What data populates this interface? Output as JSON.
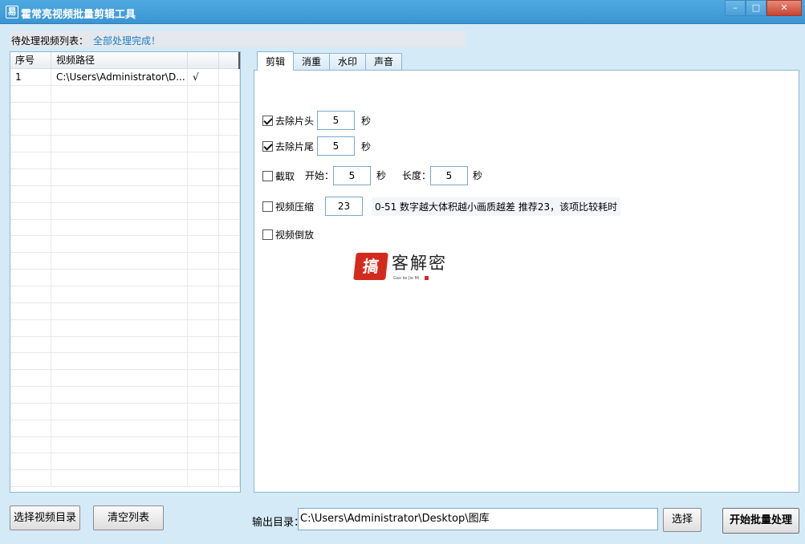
{
  "window": {
    "title": "霍常亮视频批量剪辑工具",
    "app_icon_glyph": "易",
    "minimize": "–",
    "maximize": "□",
    "close": "✕"
  },
  "status": {
    "label": "待处理视频列表：",
    "value": "全部处理完成！",
    "value_color": "#1a7ec4"
  },
  "list": {
    "columns": [
      "序号",
      "视频路径",
      ""
    ],
    "rows": [
      {
        "index": "1",
        "path": "C:\\Users\\Administrator\\D...",
        "status": "√"
      }
    ]
  },
  "tabs": [
    "剪辑",
    "消重",
    "水印",
    "声音"
  ],
  "edit": {
    "remove_head": {
      "label": "去除片头",
      "checked": true,
      "value": "5",
      "unit": "秒"
    },
    "remove_tail": {
      "label": "去除片尾",
      "checked": true,
      "value": "5",
      "unit": "秒"
    },
    "clip": {
      "label": "截取",
      "checked": false,
      "start_label": "开始：",
      "start_value": "5",
      "start_unit": "秒",
      "length_label": "长度：",
      "length_value": "5",
      "length_unit": "秒"
    },
    "compress": {
      "label": "视频压缩",
      "checked": false,
      "value": "23",
      "hint": "0-51 数字越大体积越小画质越差 推荐23，该项比较耗时"
    },
    "reverse": {
      "label": "视频倒放",
      "checked": false
    }
  },
  "watermark": {
    "seal_text": "搞",
    "text": "客解密",
    "subtext": "Gao ke Jie Mi"
  },
  "buttons": {
    "select_dir": "选择视频目录",
    "clear_list": "清空列表",
    "choose": "选择",
    "start": "开始批量处理"
  },
  "output": {
    "label": "输出目录：",
    "path": "C:\\Users\\Administrator\\Desktop\\图库"
  }
}
